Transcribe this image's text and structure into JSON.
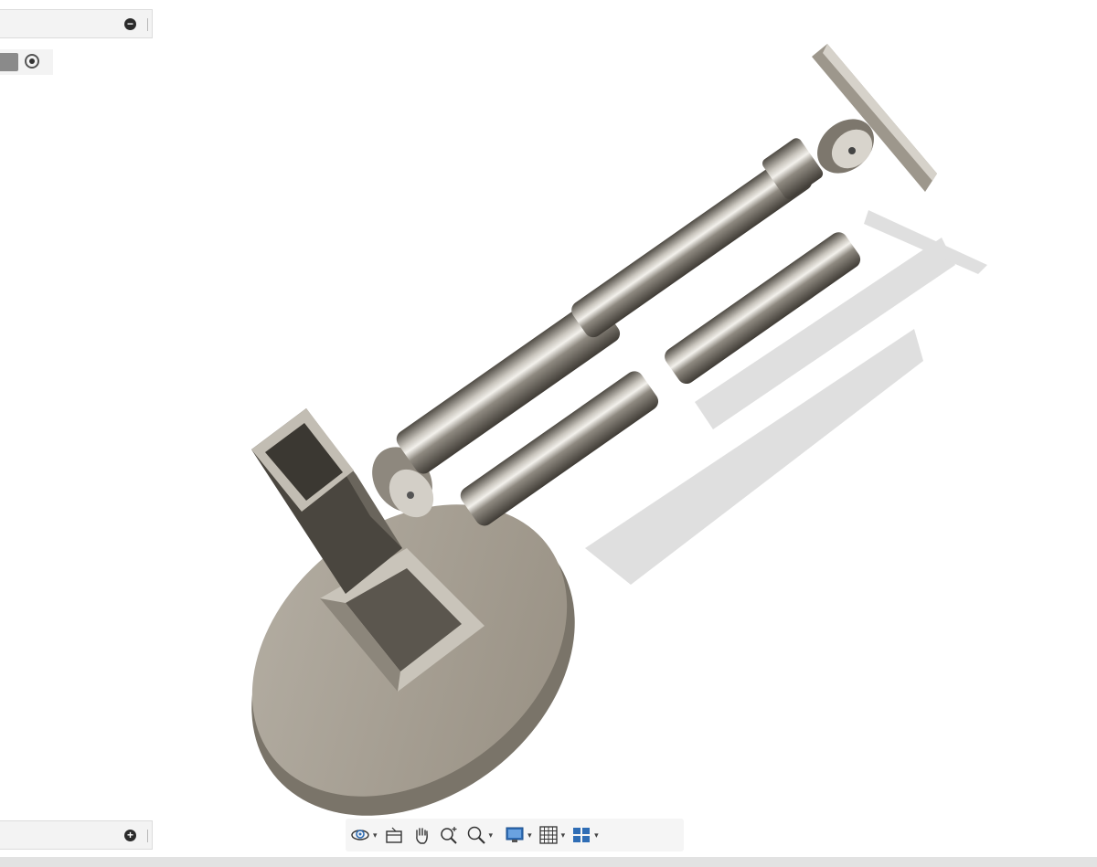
{
  "browser_panel": {
    "collapse_button": "−"
  },
  "comments_panel": {
    "expand_button": "+"
  },
  "visibility_row": {
    "icons": [
      "color-swatch-icon",
      "radio-selected-icon"
    ]
  },
  "nav_toolbar": {
    "tools": [
      {
        "name": "orbit",
        "icon": "orbit-icon",
        "has_dropdown": true
      },
      {
        "name": "look-at",
        "icon": "look-at-icon",
        "has_dropdown": false
      },
      {
        "name": "pan",
        "icon": "pan-hand-icon",
        "has_dropdown": false
      },
      {
        "name": "zoom",
        "icon": "zoom-icon",
        "has_dropdown": false
      },
      {
        "name": "fit",
        "icon": "fit-magnifier-icon",
        "has_dropdown": true
      },
      {
        "name": "display-settings",
        "icon": "monitor-icon",
        "has_dropdown": true
      },
      {
        "name": "grid-snaps",
        "icon": "grid-icon",
        "has_dropdown": true
      },
      {
        "name": "viewports",
        "icon": "viewports-icon",
        "has_dropdown": true
      }
    ],
    "dropdown_caret": "▾"
  },
  "colors": {
    "model_metal_light": "#d8d4cc",
    "model_metal_dark": "#4a463f",
    "base_plate": "#a49e92",
    "shadow": "#d9d9d9",
    "toolbar_icon_blue": "#2f6db5"
  }
}
